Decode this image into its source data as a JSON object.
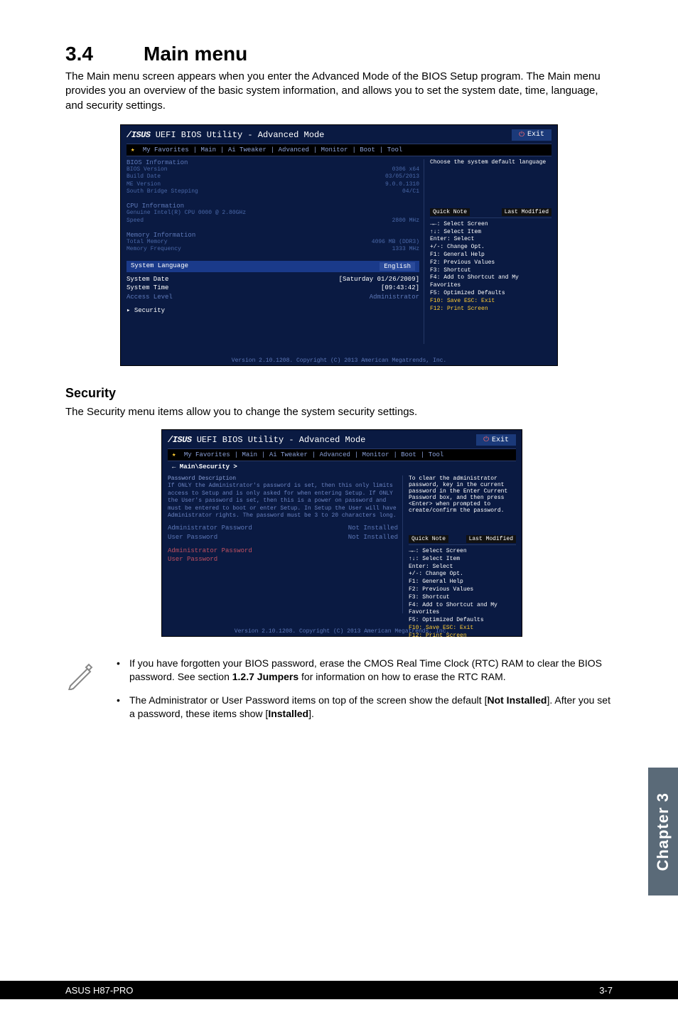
{
  "section": {
    "number": "3.4",
    "title": "Main menu"
  },
  "intro": "The Main menu screen appears when you enter the Advanced Mode of the BIOS Setup program. The Main menu provides you an overview of the basic system information, and allows you to set the system date, time, language, and security settings.",
  "bios_main": {
    "title": "UEFI BIOS Utility - Advanced Mode",
    "exit": "Exit",
    "menubar": [
      "★ My Favorites",
      "Main",
      "Ai Tweaker",
      "Advanced",
      "Monitor",
      "Boot",
      "Tool"
    ],
    "right_top": "Choose the system default language",
    "info1_hdr": "BIOS Information",
    "info1": [
      [
        "BIOS Version",
        "0306 x64"
      ],
      [
        "Build Date",
        "03/05/2013"
      ],
      [
        "ME Version",
        "9.0.0.1310"
      ],
      [
        "South Bridge Stepping",
        "04/C1"
      ]
    ],
    "info2_hdr": "CPU Information",
    "info2": [
      [
        "Genuine Intel(R) CPU 0000 @ 2.80GHz",
        ""
      ],
      [
        "Speed",
        "2800 MHz"
      ]
    ],
    "info3_hdr": "Memory Information",
    "info3": [
      [
        "Total Memory",
        "4096 MB (DDR3)"
      ],
      [
        "Memory Frequency",
        "1333 MHz"
      ]
    ],
    "lang_label": "System Language",
    "lang_value": "English",
    "rows": [
      [
        "System Date",
        "[Saturday 01/26/2009]"
      ],
      [
        "System Time",
        "[09:43:42]"
      ]
    ],
    "rows_blue": [
      [
        "Access Level",
        "Administrator"
      ]
    ],
    "security_item": "▸ Security",
    "help_hdr": [
      "Quick Note",
      "Last Modified"
    ],
    "help": [
      "→←: Select Screen",
      "↑↓: Select Item",
      "Enter: Select",
      "+/-: Change Opt.",
      "F1: General Help",
      "F2: Previous Values",
      "F3: Shortcut",
      "F4: Add to Shortcut and My Favorites",
      "F5: Optimized Defaults",
      "F10: Save  ESC: Exit",
      "F12: Print Screen"
    ],
    "footer": "Version 2.10.1208. Copyright (C) 2013 American Megatrends, Inc."
  },
  "security": {
    "heading": "Security",
    "intro": "The Security menu items allow you to change the system security settings.",
    "bios": {
      "title": "UEFI BIOS Utility - Advanced Mode",
      "exit": "Exit",
      "menubar": [
        "★ My Favorites",
        "Main",
        "Ai Tweaker",
        "Advanced",
        "Monitor",
        "Boot",
        "Tool"
      ],
      "crumb_back": "← Main\\Security >",
      "desc_hdr": "Password Description",
      "desc": "If ONLY the Administrator's password is set, then this only limits access to Setup and is only asked for when entering Setup. If ONLY the User's password is set, then this is a power on password and must be entered to boot or enter Setup. In Setup the User will have Administrator rights. The password must be 3 to 20 characters long.",
      "rows": [
        [
          "Administrator Password",
          "Not Installed"
        ],
        [
          "User Password",
          "Not Installed"
        ]
      ],
      "red_rows": [
        "Administrator Password",
        "User Password"
      ],
      "right_top": "To clear the administrator password, key in the current password in the Enter Current Password box, and then press <Enter> when prompted to create/confirm the password.",
      "help_hdr": [
        "Quick Note",
        "Last Modified"
      ],
      "help": [
        "→←: Select Screen",
        "↑↓: Select Item",
        "Enter: Select",
        "+/-: Change Opt.",
        "F1: General Help",
        "F2: Previous Values",
        "F3: Shortcut",
        "F4: Add to Shortcut and My Favorites",
        "F5: Optimized Defaults",
        "F10: Save  ESC: Exit",
        "F12: Print Screen"
      ],
      "footer": "Version 2.10.1208. Copyright (C) 2013 American Megatrends, Inc."
    }
  },
  "notes": [
    "If you have forgotten your BIOS password, erase the CMOS Real Time Clock (RTC) RAM to clear the BIOS password. See section 1.2.7 Jumpers for information on how to erase the RTC RAM.",
    "The Administrator or User Password items on top of the screen show the default [Not Installed]. After you set a password, these items show [Installed]."
  ],
  "notes_html": [
    "If you have forgotten your BIOS password, erase the CMOS Real Time Clock (RTC) RAM to clear the BIOS password. See section <b>1.2.7 Jumpers</b> for information on how to erase the RTC RAM.",
    "The Administrator or User Password items on top of the screen show the default [<b>Not Installed</b>]. After you set a password, these items show [<b>Installed</b>]."
  ],
  "chapter_tab": "Chapter 3",
  "footer": {
    "left": "ASUS H87-PRO",
    "right": "3-7"
  }
}
